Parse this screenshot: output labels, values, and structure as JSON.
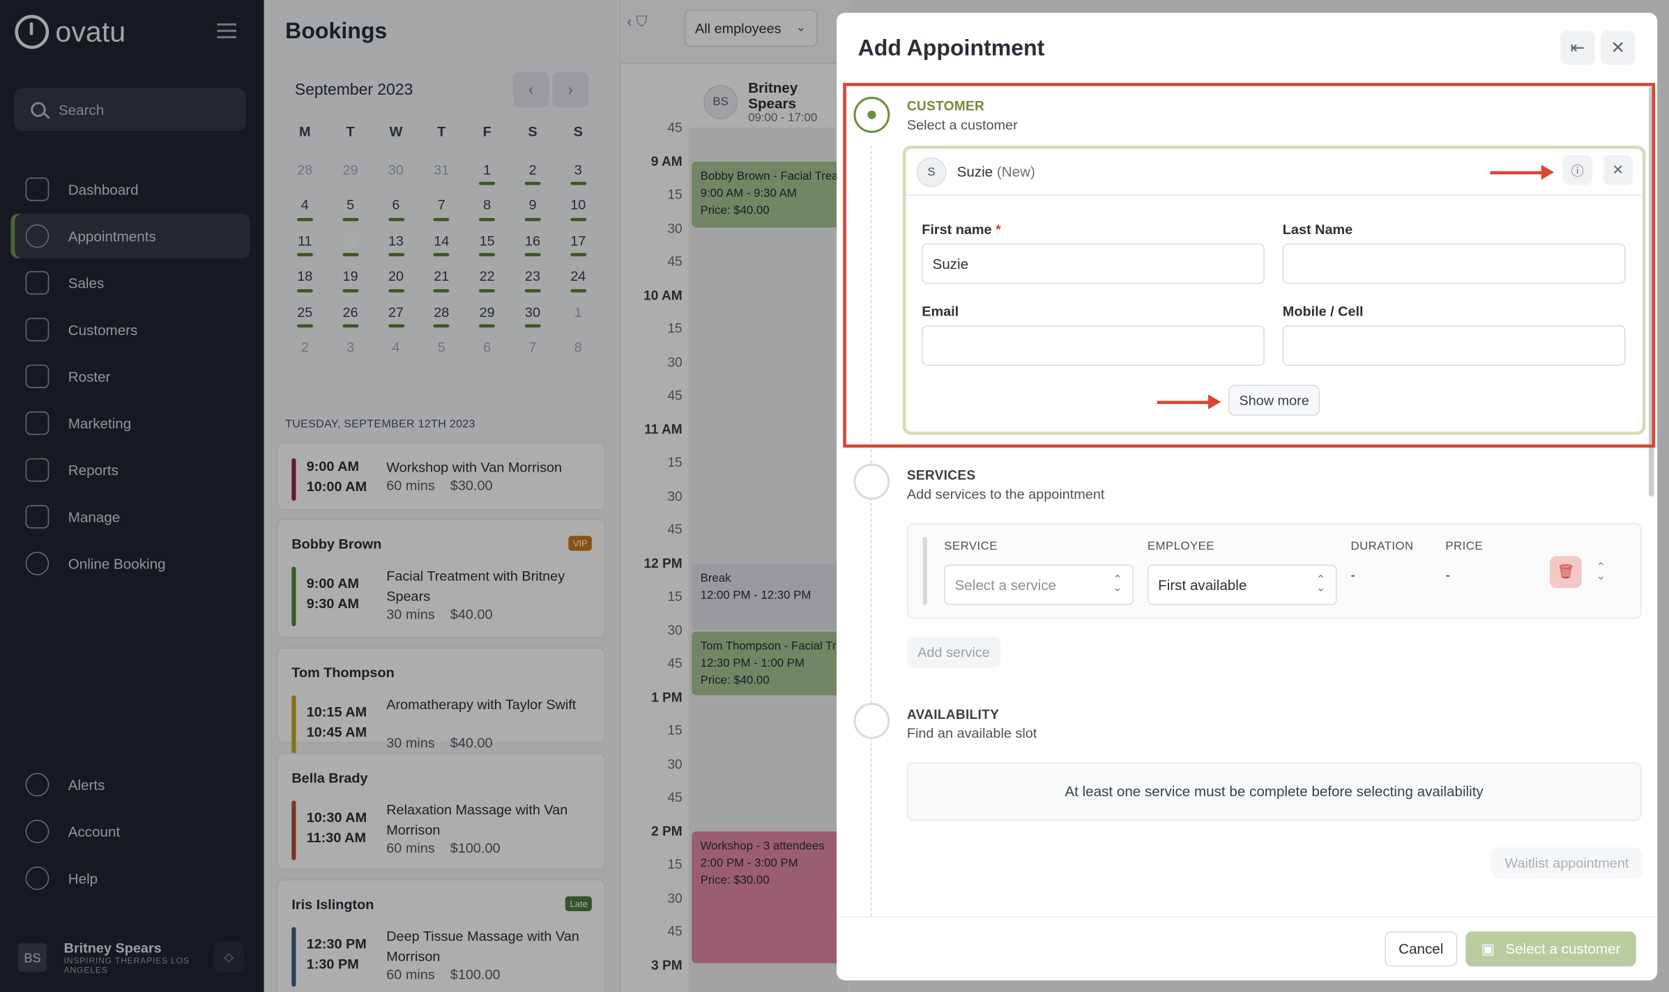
{
  "sidebar": {
    "brand": "ovatu",
    "search_label": "Search",
    "items": [
      {
        "label": "Dashboard",
        "icon": "home-icon"
      },
      {
        "label": "Appointments",
        "icon": "clock-icon"
      },
      {
        "label": "Sales",
        "icon": "tag-icon"
      },
      {
        "label": "Customers",
        "icon": "users-icon"
      },
      {
        "label": "Roster",
        "icon": "calendar-icon"
      },
      {
        "label": "Marketing",
        "icon": "megaphone-icon"
      },
      {
        "label": "Reports",
        "icon": "chart-icon"
      },
      {
        "label": "Manage",
        "icon": "gears-icon"
      },
      {
        "label": "Online Booking",
        "icon": "globe-icon"
      }
    ],
    "bottom_items": [
      {
        "label": "Alerts",
        "icon": "bell-icon"
      },
      {
        "label": "Account",
        "icon": "account-icon"
      },
      {
        "label": "Help",
        "icon": "help-icon"
      }
    ],
    "user": {
      "initials": "BS",
      "name": "Britney Spears",
      "org": "INSPIRING THERAPIES LOS ANGELES"
    }
  },
  "bookings": {
    "title": "Bookings",
    "month": "September 2023",
    "weekdays": [
      "M",
      "T",
      "W",
      "T",
      "F",
      "S",
      "S"
    ],
    "day_heading": "TUESDAY, SEPTEMBER 12TH 2023",
    "cards": [
      {
        "name": "",
        "start": "9:00 AM",
        "end": "10:00 AM",
        "desc": "Workshop with Van Morrison",
        "duration": "60 mins",
        "price": "$30.00",
        "strip": "#8e2a4a",
        "badge": ""
      },
      {
        "name": "Bobby Brown",
        "start": "9:00 AM",
        "end": "9:30 AM",
        "desc": "Facial Treatment with Britney Spears",
        "duration": "30 mins",
        "price": "$40.00",
        "strip": "#4e8a36",
        "badge": "VIP",
        "badge_color": "#c97a1e"
      },
      {
        "name": "Tom Thompson",
        "start": "10:15 AM",
        "end": "10:45 AM",
        "desc": "Aromatherapy with Taylor Swift",
        "duration": "30 mins",
        "price": "$40.00",
        "strip": "#c8a21c",
        "badge": ""
      },
      {
        "name": "Bella Brady",
        "start": "10:30 AM",
        "end": "11:30 AM",
        "desc": "Relaxation Massage with Van Morrison",
        "duration": "60 mins",
        "price": "$100.00",
        "strip": "#b84e30",
        "badge": ""
      },
      {
        "name": "Iris Islington",
        "start": "12:30 PM",
        "end": "1:30 PM",
        "desc": "Deep Tissue Massage with Van Morrison",
        "duration": "60 mins",
        "price": "$100.00",
        "strip": "#3d5a86",
        "badge": "Late",
        "badge_color": "#4f7d3a"
      }
    ]
  },
  "schedule": {
    "filter_label": "All employees",
    "employee": {
      "initials": "BS",
      "name": "Britney Spears",
      "hours": "09:00 - 17:00"
    },
    "times": [
      {
        "t": "45",
        "hour": false
      },
      {
        "t": "9 AM",
        "hour": true
      },
      {
        "t": "15",
        "hour": false
      },
      {
        "t": "30",
        "hour": false
      },
      {
        "t": "45",
        "hour": false
      },
      {
        "t": "10 AM",
        "hour": true
      },
      {
        "t": "15",
        "hour": false
      },
      {
        "t": "30",
        "hour": false
      },
      {
        "t": "45",
        "hour": false
      },
      {
        "t": "11 AM",
        "hour": true
      },
      {
        "t": "15",
        "hour": false
      },
      {
        "t": "30",
        "hour": false
      },
      {
        "t": "45",
        "hour": false
      },
      {
        "t": "12 PM",
        "hour": true
      },
      {
        "t": "15",
        "hour": false
      },
      {
        "t": "30",
        "hour": false
      },
      {
        "t": "45",
        "hour": false
      },
      {
        "t": "1 PM",
        "hour": true
      },
      {
        "t": "15",
        "hour": false
      },
      {
        "t": "30",
        "hour": false
      },
      {
        "t": "45",
        "hour": false
      },
      {
        "t": "2 PM",
        "hour": true
      },
      {
        "t": "15",
        "hour": false
      },
      {
        "t": "30",
        "hour": false
      },
      {
        "t": "45",
        "hour": false
      },
      {
        "t": "3 PM",
        "hour": true
      }
    ],
    "events": [
      {
        "title": "Bobby Brown - Facial Treatment",
        "time": "9:00 AM - 9:30 AM",
        "price": "Price: $40.00",
        "color": "#a9c596"
      },
      {
        "title": "Break",
        "time": "12:00 PM - 12:30 PM",
        "price": "",
        "color": "#e2e4e8"
      },
      {
        "title": "Tom Thompson - Facial Treatment",
        "time": "12:30 PM - 1:00 PM",
        "price": "Price: $40.00",
        "color": "#a9c596"
      },
      {
        "title": "Workshop - 3 attendees",
        "time": "2:00 PM - 3:00 PM",
        "price": "Price: $30.00",
        "color": "#e58aa6"
      }
    ]
  },
  "modal": {
    "title": "Add Appointment",
    "customer": {
      "step_title": "CUSTOMER",
      "step_sub": "Select a customer",
      "initial": "S",
      "name": "Suzie",
      "new_tag": "(New)",
      "first_name_label": "First name",
      "required_mark": "*",
      "first_name_value": "Suzie",
      "last_name_label": "Last Name",
      "last_name_value": "",
      "email_label": "Email",
      "email_value": "",
      "mobile_label": "Mobile / Cell",
      "mobile_value": "",
      "show_more": "Show more"
    },
    "services": {
      "step_title": "SERVICES",
      "step_sub": "Add services to the appointment",
      "col_service": "SERVICE",
      "col_employee": "EMPLOYEE",
      "col_duration": "DURATION",
      "col_price": "PRICE",
      "service_placeholder": "Select a service",
      "employee_value": "First available",
      "duration_value": "-",
      "price_value": "-",
      "add_service": "Add service"
    },
    "availability": {
      "step_title": "AVAILABILITY",
      "step_sub": "Find an available slot",
      "notice": "At least one service must be complete before selecting availability",
      "waitlist": "Waitlist appointment"
    },
    "footer": {
      "cancel": "Cancel",
      "submit": "Select a customer"
    }
  },
  "colors": {
    "accent_green": "#6e8e3c",
    "highlight_red": "#d94632",
    "selected_day": "#2a66a8"
  }
}
